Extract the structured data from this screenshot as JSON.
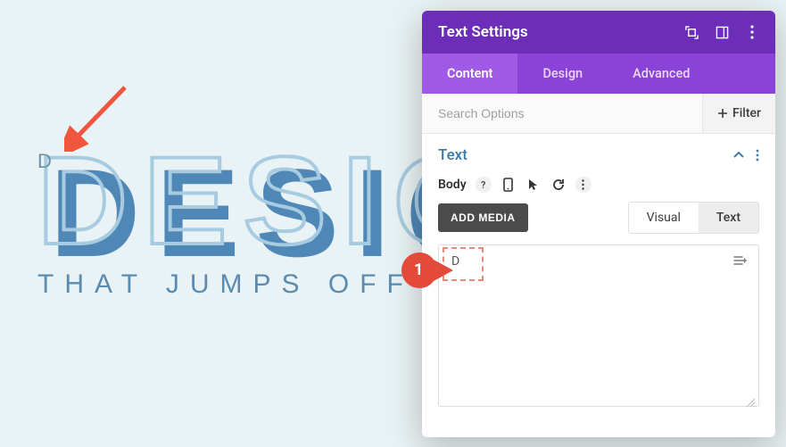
{
  "canvas": {
    "big_word": "DESIGN",
    "editing_letter": "D",
    "subtitle": "THAT JUMPS OFF TH"
  },
  "annotation": {
    "step_number": "1"
  },
  "panel": {
    "title": "Text Settings",
    "tabs": {
      "content": "Content",
      "design": "Design",
      "advanced": "Advanced"
    },
    "search_placeholder": "Search Options",
    "filter_label": "Filter",
    "section": {
      "title": "Text",
      "body_label": "Body",
      "add_media": "ADD MEDIA",
      "editor_tabs": {
        "visual": "Visual",
        "text": "Text"
      },
      "editor_value": "D"
    }
  }
}
